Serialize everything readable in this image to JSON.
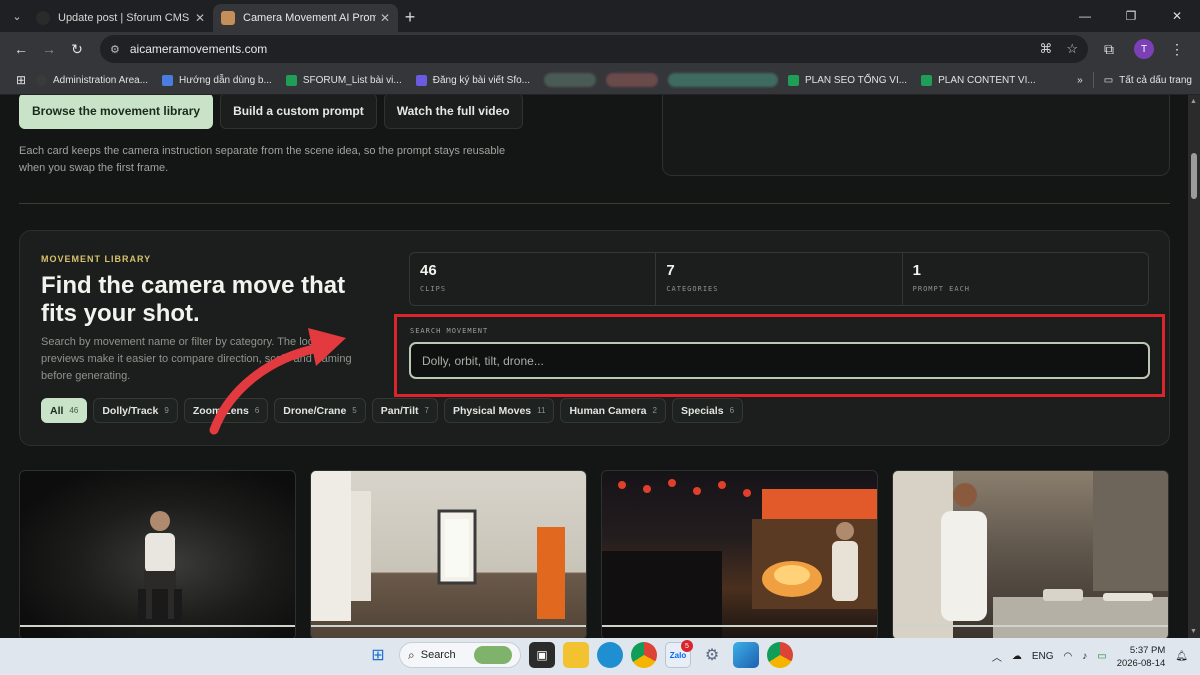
{
  "browser": {
    "tabs": [
      {
        "title": "Update post | Sforum CMS",
        "active": false
      },
      {
        "title": "Camera Movement AI Prompts",
        "active": true
      }
    ],
    "url": "aicameramovements.com",
    "profile_initial": "T",
    "bookmarks": [
      {
        "label": "Administration Area...",
        "color": "#3a3a3a"
      },
      {
        "label": "Hướng dẫn dùng b...",
        "color": "#4a7de0"
      },
      {
        "label": "SFORUM_List bài vi...",
        "color": "#1e9e56"
      },
      {
        "label": "Đăng ký bài viết Sfo...",
        "color": "#6a5be0"
      },
      {
        "label": "PLAN SEO TỔNG VI...",
        "color": "#1e9e56"
      },
      {
        "label": "PLAN CONTENT VI...",
        "color": "#1e9e56"
      }
    ],
    "bookmarks_more": "»",
    "all_bookmarks": "Tất cả dấu trang"
  },
  "hero": {
    "buttons": [
      {
        "label": "Browse the movement library",
        "primary": true
      },
      {
        "label": "Build a custom prompt",
        "primary": false
      },
      {
        "label": "Watch the full video",
        "primary": false
      }
    ],
    "note": "Each card keeps the camera instruction separate from the scene idea, so the prompt stays reusable when you swap the first frame."
  },
  "library": {
    "eyebrow": "MOVEMENT LIBRARY",
    "headline": "Find the camera move that fits your shot.",
    "description": "Search by movement name or filter by category. The looping previews make it easier to compare direction, scale and framing before generating.",
    "stats": [
      {
        "value": "46",
        "label": "CLIPS"
      },
      {
        "value": "7",
        "label": "CATEGORIES"
      },
      {
        "value": "1",
        "label": "PROMPT EACH"
      }
    ],
    "search": {
      "label": "SEARCH MOVEMENT",
      "placeholder": "Dolly, orbit, tilt, drone..."
    },
    "filters": [
      {
        "label": "All",
        "count": "46",
        "active": true
      },
      {
        "label": "Dolly/Track",
        "count": "9",
        "active": false
      },
      {
        "label": "Zoom/Lens",
        "count": "6",
        "active": false
      },
      {
        "label": "Drone/Crane",
        "count": "5",
        "active": false
      },
      {
        "label": "Pan/Tilt",
        "count": "7",
        "active": false
      },
      {
        "label": "Physical Moves",
        "count": "11",
        "active": false
      },
      {
        "label": "Human Camera",
        "count": "2",
        "active": false
      },
      {
        "label": "Specials",
        "count": "6",
        "active": false
      }
    ]
  },
  "annotation": {
    "highlight_color": "#d9252b"
  },
  "taskbar": {
    "search_label": "Search",
    "language": "ENG",
    "time": "5:37 PM",
    "date": "2026-08-14",
    "notification_badge": "5"
  }
}
